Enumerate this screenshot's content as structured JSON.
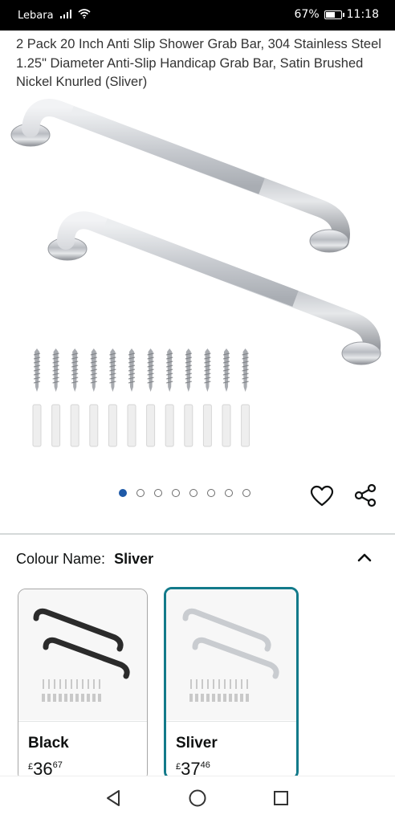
{
  "status_bar": {
    "carrier": "Lebara",
    "battery": "67%",
    "battery_level": 0.67,
    "time": "11:18"
  },
  "product": {
    "title": "2 Pack 20 Inch Anti Slip Shower Grab Bar, 304 Stainless Steel 1.25\" Diameter Anti-Slip Handicap Grab Bar, Satin Brushed Nickel Knurled (Sliver)"
  },
  "carousel": {
    "total": 8,
    "active_index": 0
  },
  "colour": {
    "label": "Colour Name:",
    "selected": "Sliver"
  },
  "swatches": [
    {
      "name": "Black",
      "currency": "£",
      "whole": "36",
      "fraction": "67",
      "color": "#2b2b2b"
    },
    {
      "name": "Sliver",
      "currency": "£",
      "whole": "37",
      "fraction": "46",
      "color": "#c9ccd0"
    }
  ],
  "colors": {
    "accent_blue": "#1e5aa8",
    "selected_border": "#127a8a"
  }
}
